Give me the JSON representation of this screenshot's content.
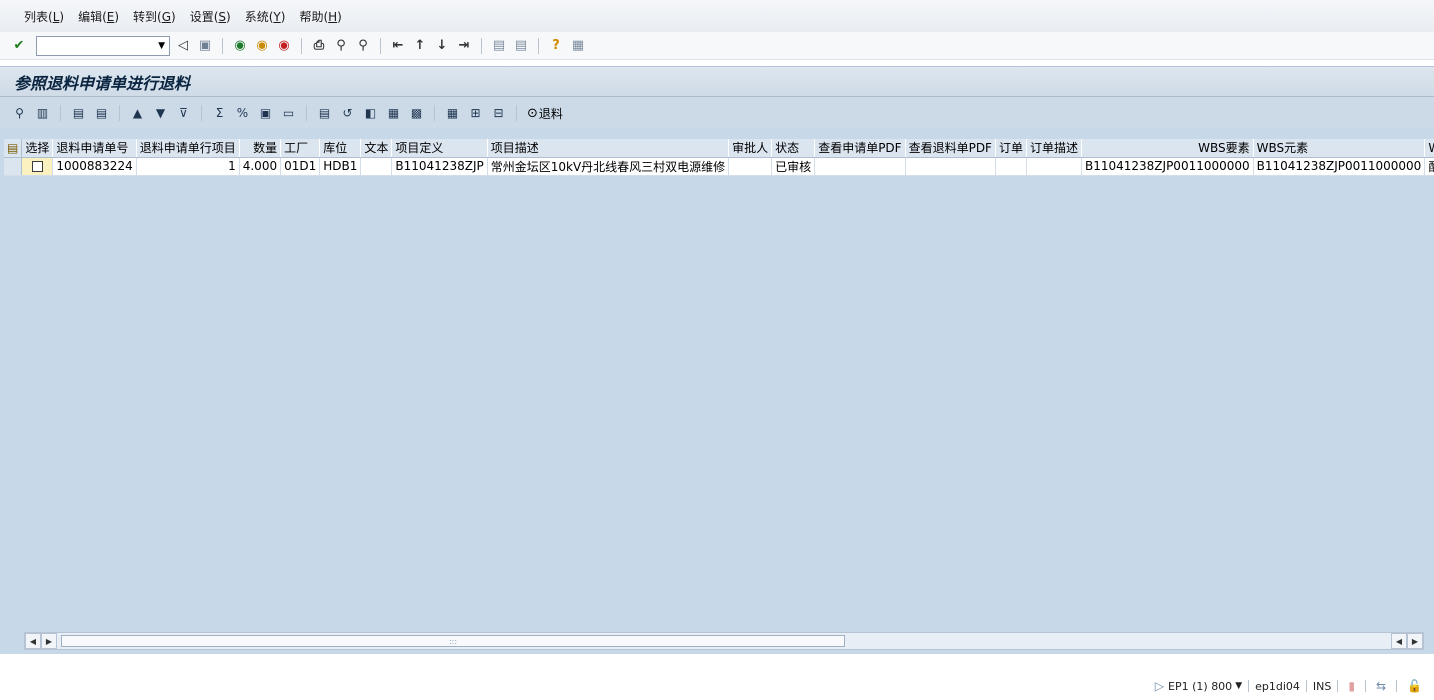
{
  "menu": [
    {
      "label": "列表(",
      "accel": "L",
      "suffix": ")"
    },
    {
      "label": "编辑(",
      "accel": "E",
      "suffix": ")"
    },
    {
      "label": "转到(",
      "accel": "G",
      "suffix": ")"
    },
    {
      "label": "设置(",
      "accel": "S",
      "suffix": ")"
    },
    {
      "label": "系统(",
      "accel": "Y",
      "suffix": ")"
    },
    {
      "label": "帮助(",
      "accel": "H",
      "suffix": ")"
    }
  ],
  "command_field": {
    "value": ""
  },
  "title": "参照退料申请单进行退料",
  "app_toolbar": {
    "return_button_label": "退料"
  },
  "table": {
    "columns": [
      "选择",
      "退料申请单号",
      "退料申请单行项目",
      "数量",
      "工厂",
      "库位",
      "文本",
      "项目定义",
      "项目描述",
      "审批人",
      "状态",
      "查看申请单PDF",
      "查看退料单PDF",
      "订单",
      "订单描述",
      "WBS要素",
      "WBS元素",
      "WBS描"
    ],
    "rows": [
      [
        "",
        "1000883224",
        "1",
        "4.000",
        "01D1",
        "HDB1",
        "",
        "B11041238ZJP",
        "常州金坛区10kV丹北线春风三村双电源维修",
        "",
        "已审核",
        "",
        "",
        "",
        "",
        "B11041238ZJP0011000000",
        "B11041238ZJP0011000000",
        "配网检"
      ]
    ]
  },
  "status_bar": {
    "system": "EP1 (1) 800",
    "server": "ep1di04",
    "mode": "INS"
  }
}
